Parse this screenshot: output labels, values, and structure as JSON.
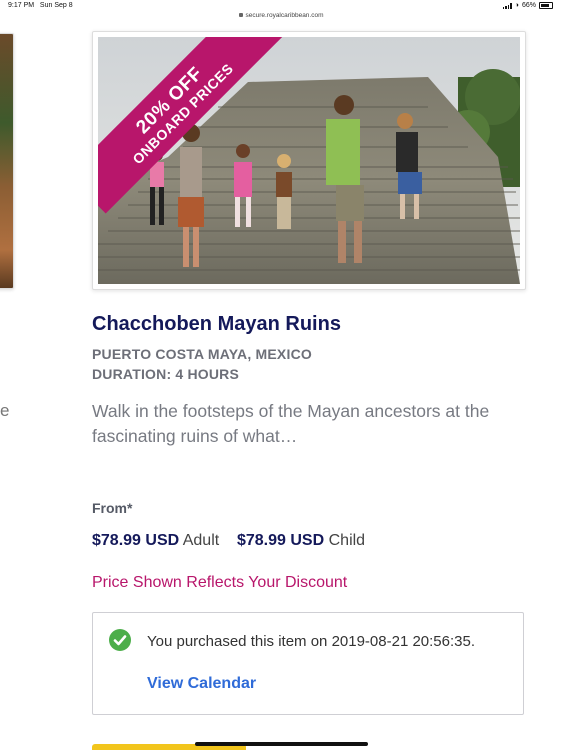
{
  "status_bar": {
    "time": "9:17 PM",
    "date": "Sun Sep 8",
    "battery": "66%",
    "url": "secure.royalcaribbean.com"
  },
  "prev_card": {
    "partial_text": "e"
  },
  "tour": {
    "ribbon_percent": "20% OFF",
    "ribbon_sub": "ONBOARD PRICES",
    "title": "Chacchoben Mayan Ruins",
    "location": "PUERTO COSTA MAYA, MEXICO",
    "duration": "DURATION: 4 HOURS",
    "description": "Walk in the footsteps of the Mayan ancestors at the fascinating ruins of what…",
    "from_label": "From*",
    "adult_price": "$78.99 USD",
    "adult_label": "Adult",
    "child_price": "$78.99 USD",
    "child_label": "Child",
    "discount_note": "Price Shown Reflects Your Discount"
  },
  "purchase": {
    "message": "You purchased this item on 2019-08-21 20:56:35.",
    "link_label": "View Calendar",
    "icon": "check-circle-icon"
  },
  "colors": {
    "brand_navy": "#14195a",
    "ribbon_pink": "#b8166b",
    "link_blue": "#2f6bd8",
    "success_green": "#4cae4a"
  }
}
